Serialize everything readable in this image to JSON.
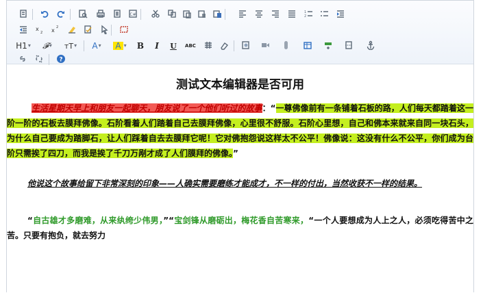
{
  "toolbar": {
    "row1": [
      {
        "name": "fullscreen-icon"
      },
      {
        "name": "undo-icon"
      },
      {
        "name": "redo-icon"
      },
      {
        "name": "preview-icon"
      },
      {
        "name": "print-icon"
      },
      {
        "name": "template-icon"
      },
      {
        "name": "source-code-icon"
      },
      {
        "name": "cut-icon"
      },
      {
        "name": "copy-icon"
      },
      {
        "name": "paste-icon"
      },
      {
        "name": "paste-text-icon"
      },
      {
        "name": "paste-word-icon"
      },
      {
        "name": "align-left-icon"
      },
      {
        "name": "align-center-icon"
      },
      {
        "name": "align-right-icon"
      },
      {
        "name": "align-justify-icon"
      },
      {
        "name": "numbered-list-icon"
      },
      {
        "name": "bullet-list-icon"
      },
      {
        "name": "indent-icon"
      }
    ],
    "row2": [
      {
        "name": "outdent-icon"
      },
      {
        "name": "subscript-icon"
      },
      {
        "name": "superscript-icon"
      },
      {
        "name": "clear-format-icon"
      },
      {
        "name": "spellcheck-icon"
      },
      {
        "name": "select-all-icon"
      },
      {
        "name": "maximize-icon"
      }
    ],
    "row3": {
      "heading_label": "H1",
      "font_family_glyph": "𝓕",
      "font_size_label": "ᴛT",
      "font_color_label": "A",
      "highlight_label": "A",
      "bold_label": "B",
      "italic_label": "I",
      "underline_label": "U",
      "strikethrough_label": "ABC"
    },
    "colors": {
      "highlight": "#ffe500"
    }
  },
  "document": {
    "title": "测试文本编辑器是否可用",
    "p1": {
      "intro": "生活星期天早上和朋友一起聊天，朋友说了一个他们听过的故事",
      "sep": "：",
      "quote_open": "“",
      "story": "一尊佛像前有一条铺着石板的路，人们每天都踏着这一阶一阶的石板去膜拜佛像。石阶看着人们踏着自己去膜拜佛像，心里很不舒服。石阶心里想，自己和佛本来就来自同一块石头，为什么自己要成为踏脚石，让人们踩着自去去膜拜它呢！它对佛抱怨说这样太不公平！佛像说：这没有什么不公平，你们成为台阶只需挨了四刀，而我是挨了千刀万剐才成了人们膜拜的佛像。",
      "quote_close": "”"
    },
    "p2": "他说这个故事给留下非常深刻的印象——人确实需要磨练才能成才，不一样的付出，当然收获不一样的结果。",
    "p3": {
      "open": "“",
      "green1": "自古雄才多磨难，从来纨绔少伟男，",
      "mid": "”“",
      "green2": "宝剑锋从磨砺出，梅花香自苦寒来，",
      "rest": "“一个人要想成为人上之人，必须吃得苦中之苦。只要有抱负，就去努力"
    }
  }
}
